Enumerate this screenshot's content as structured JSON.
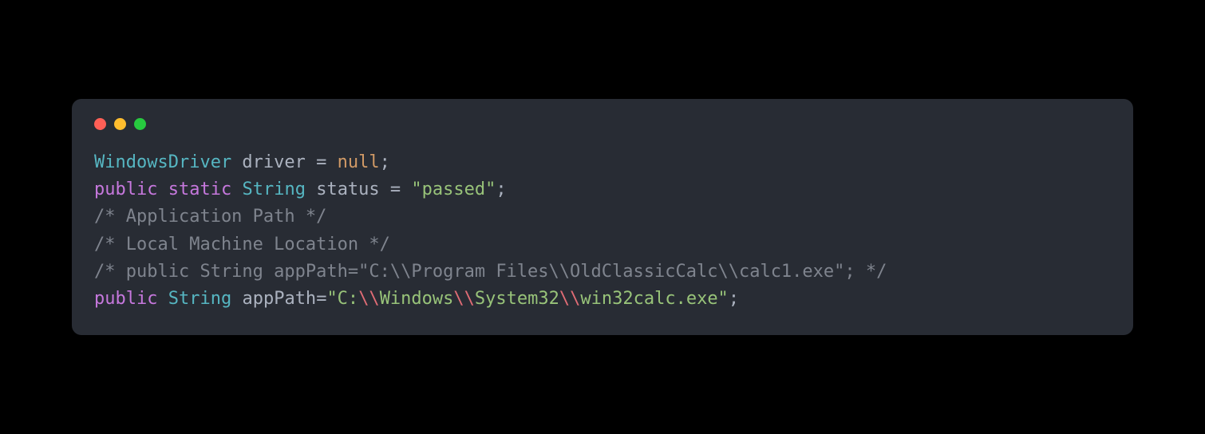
{
  "window": {
    "controls": [
      "close",
      "minimize",
      "maximize"
    ]
  },
  "code": {
    "lines": [
      {
        "tokens": [
          {
            "cls": "tk-type",
            "t": "WindowsDriver"
          },
          {
            "cls": "tk-plain",
            "t": " driver "
          },
          {
            "cls": "tk-punct",
            "t": "="
          },
          {
            "cls": "tk-plain",
            "t": " "
          },
          {
            "cls": "tk-null",
            "t": "null"
          },
          {
            "cls": "tk-punct",
            "t": ";"
          }
        ]
      },
      {
        "tokens": [
          {
            "cls": "tk-keyword",
            "t": "public"
          },
          {
            "cls": "tk-plain",
            "t": " "
          },
          {
            "cls": "tk-keyword",
            "t": "static"
          },
          {
            "cls": "tk-plain",
            "t": " "
          },
          {
            "cls": "tk-type",
            "t": "String"
          },
          {
            "cls": "tk-plain",
            "t": " status "
          },
          {
            "cls": "tk-punct",
            "t": "="
          },
          {
            "cls": "tk-plain",
            "t": " "
          },
          {
            "cls": "tk-string",
            "t": "\"passed\""
          },
          {
            "cls": "tk-punct",
            "t": ";"
          }
        ]
      },
      {
        "tokens": [
          {
            "cls": "tk-comment",
            "t": "/* Application Path */"
          }
        ]
      },
      {
        "tokens": [
          {
            "cls": "tk-comment",
            "t": "/* Local Machine Location */"
          }
        ]
      },
      {
        "tokens": [
          {
            "cls": "tk-comment",
            "t": "/* public String appPath=\"C:\\\\Program Files\\\\OldClassicCalc\\\\calc1.exe\"; */"
          }
        ]
      },
      {
        "tokens": [
          {
            "cls": "tk-keyword",
            "t": "public"
          },
          {
            "cls": "tk-plain",
            "t": " "
          },
          {
            "cls": "tk-type",
            "t": "String"
          },
          {
            "cls": "tk-plain",
            "t": " appPath"
          },
          {
            "cls": "tk-punct",
            "t": "="
          },
          {
            "cls": "tk-string",
            "t": "\"C:"
          },
          {
            "cls": "tk-escape",
            "t": "\\\\"
          },
          {
            "cls": "tk-string",
            "t": "Windows"
          },
          {
            "cls": "tk-escape",
            "t": "\\\\"
          },
          {
            "cls": "tk-string",
            "t": "System32"
          },
          {
            "cls": "tk-escape",
            "t": "\\\\"
          },
          {
            "cls": "tk-string",
            "t": "win32calc.exe\""
          },
          {
            "cls": "tk-punct",
            "t": ";"
          }
        ]
      }
    ]
  }
}
